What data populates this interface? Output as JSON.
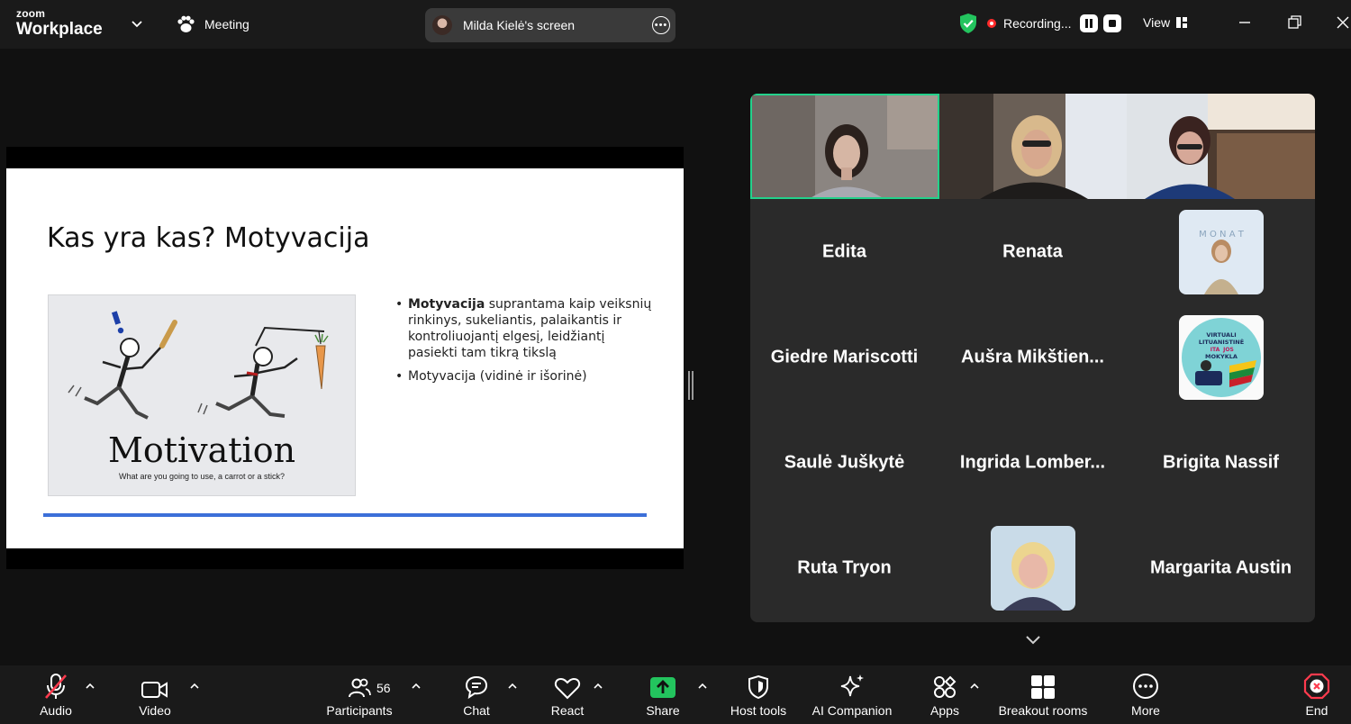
{
  "brand": {
    "line1": "zoom",
    "line2": "Workplace"
  },
  "header": {
    "meeting_label": "Meeting",
    "share_title": "Milda Kielė's screen",
    "recording_label": "Recording...",
    "view_label": "View"
  },
  "slide": {
    "title": "Kas yra kas? Motyvacija",
    "bullet1_bold": "Motyvacija",
    "bullet1_rest": " suprantama kaip veiksnių rinkinys, sukeliantis, palaikantis ir kontroliuojantį elgesį, leidžiantį pasiekti tam tikrą tikslą",
    "bullet2": "Motyvacija (vidinė ir išorinė)",
    "image_title": "Motivation",
    "image_caption": "What are you going to use, a carrot or a stick?"
  },
  "gallery": {
    "participants": [
      {
        "name": "Edita"
      },
      {
        "name": "Renata"
      },
      {
        "name": "Giedre Mariscotti"
      },
      {
        "name": "Aušra  Mikštien..."
      },
      {
        "name": "Saulė Juškytė"
      },
      {
        "name": "Ingrida  Lomber..."
      },
      {
        "name": "Brigita Nassif"
      },
      {
        "name": "Ruta Tryon"
      },
      {
        "name": "Margarita Austin"
      }
    ],
    "monat_logo_text": "M O N A T",
    "school_logo_lines": [
      "VIRTUALI",
      "LITUANISTINĖ",
      "ITA",
      "JOS",
      "MOKYKLA"
    ]
  },
  "toolbar": {
    "audio": "Audio",
    "video": "Video",
    "participants": "Participants",
    "participants_count": "56",
    "chat": "Chat",
    "react": "React",
    "share": "Share",
    "host_tools": "Host tools",
    "ai_companion": "AI Companion",
    "apps": "Apps",
    "breakout_rooms": "Breakout rooms",
    "more": "More",
    "end": "End"
  },
  "colors": {
    "active_speaker_border": "#23d18b",
    "share_green": "#23c45e",
    "end_red": "#ff3b4e",
    "slide_rule_blue": "#3c6fd8"
  }
}
